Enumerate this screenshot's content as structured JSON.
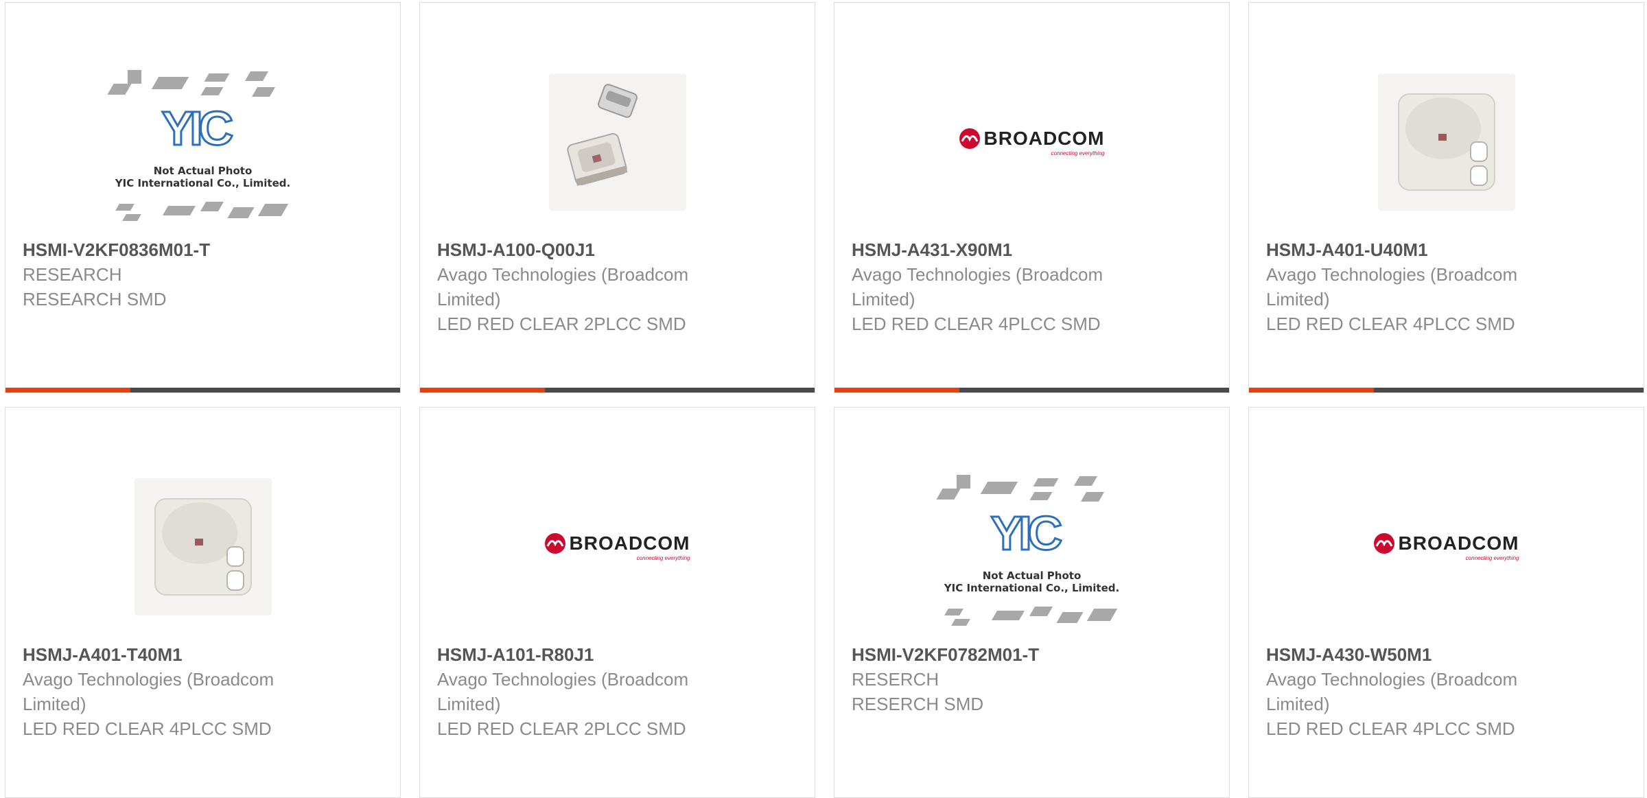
{
  "products": [
    {
      "part_number": "HSMI-V2KF0836M01-T",
      "manufacturer": "RESEARCH",
      "description": "RESEARCH SMD",
      "image": "yic-not-actual-photo",
      "image_text": {
        "line1": "Not Actual Photo",
        "line2": "YIC International Co., Limited.",
        "logo": "YIC"
      }
    },
    {
      "part_number": "HSMJ-A100-Q00J1",
      "manufacturer": "Avago Technologies (Broadcom Limited)",
      "description": "LED RED CLEAR 2PLCC SMD",
      "image": "led-2plcc-photo"
    },
    {
      "part_number": "HSMJ-A431-X90M1",
      "manufacturer": "Avago Technologies (Broadcom Limited)",
      "description": "LED RED CLEAR 4PLCC SMD",
      "image": "broadcom-logo",
      "logo_text": {
        "word": "BROADCOM",
        "tag": "connecting everything"
      }
    },
    {
      "part_number": "HSMJ-A401-U40M1",
      "manufacturer": "Avago Technologies (Broadcom Limited)",
      "description": "LED RED CLEAR 4PLCC SMD",
      "image": "led-4plcc-photo"
    },
    {
      "part_number": "HSMJ-A401-T40M1",
      "manufacturer": "Avago Technologies (Broadcom Limited)",
      "description": "LED RED CLEAR 4PLCC SMD",
      "image": "led-4plcc-photo"
    },
    {
      "part_number": "HSMJ-A101-R80J1",
      "manufacturer": "Avago Technologies (Broadcom Limited)",
      "description": "LED RED CLEAR 2PLCC SMD",
      "image": "broadcom-logo",
      "logo_text": {
        "word": "BROADCOM",
        "tag": "connecting everything"
      }
    },
    {
      "part_number": "HSMI-V2KF0782M01-T",
      "manufacturer": "RESERCH",
      "description": "RESERCH SMD",
      "image": "yic-not-actual-photo",
      "image_text": {
        "line1": "Not Actual Photo",
        "line2": "YIC International Co., Limited.",
        "logo": "YIC"
      }
    },
    {
      "part_number": "HSMJ-A430-W50M1",
      "manufacturer": "Avago Technologies (Broadcom Limited)",
      "description": "LED RED CLEAR 4PLCC SMD",
      "image": "broadcom-logo",
      "logo_text": {
        "word": "BROADCOM",
        "tag": "connecting everything"
      }
    }
  ],
  "colors": {
    "accent_bar": "#e8400c",
    "bar_dark": "#4a4a4a",
    "broadcom_red": "#cc092f",
    "yic_blue": "#2d6fb8"
  }
}
